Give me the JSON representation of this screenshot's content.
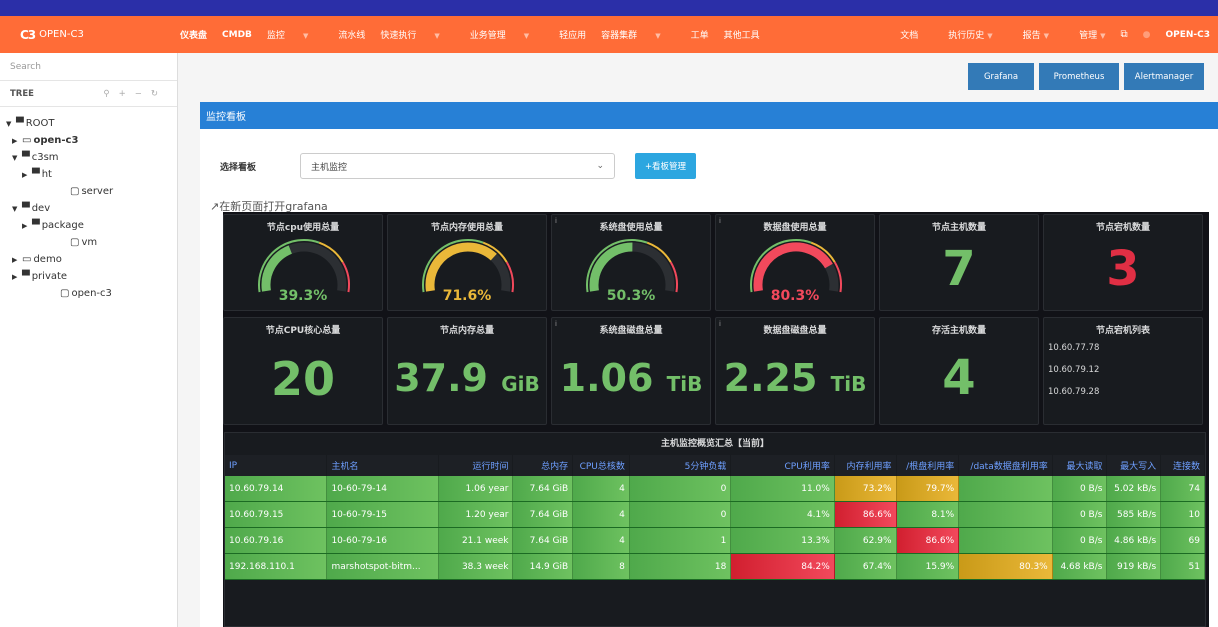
{
  "app": {
    "logo_mark": "C3",
    "logo_text": "OPEN-C3"
  },
  "nav": [
    "仪表盘",
    "CMDB",
    "监控",
    "流水线",
    "快速执行",
    "业务管理",
    "轻应用",
    "容器集群",
    "工单",
    "其他工具"
  ],
  "nav_right": {
    "docs": "文档",
    "history": "执行历史",
    "reports": "报告",
    "admin": "管理",
    "user": "OPEN-C3"
  },
  "sidebar": {
    "search_placeholder": "Search",
    "tree_title": "TREE",
    "nodes": [
      "ROOT",
      "open-c3",
      "c3sm",
      "ht",
      "server",
      "dev",
      "package",
      "vm",
      "demo",
      "private",
      "open-c3"
    ]
  },
  "tool_buttons": [
    "Grafana",
    "Prometheus",
    "Alertmanager"
  ],
  "panel": {
    "title": "监控看板",
    "select_label": "选择看板",
    "select_value": "主机监控",
    "manage_button": "+看板管理",
    "open_link": "在新页面打开grafana"
  },
  "stats": {
    "cpu_usage": {
      "title": "节点cpu使用总量",
      "value": "39.3%",
      "percent": 39.3,
      "color": "#73bf69"
    },
    "mem_usage": {
      "title": "节点内存使用总量",
      "value": "71.6%",
      "percent": 71.6,
      "color": "#eab839"
    },
    "sys_disk": {
      "title": "系统盘使用总量",
      "value": "50.3%",
      "percent": 50.3,
      "color": "#73bf69"
    },
    "data_disk": {
      "title": "数据盘使用总量",
      "value": "80.3%",
      "percent": 80.3,
      "color": "#f2495c"
    },
    "host_count": {
      "title": "节点主机数量",
      "value": "7"
    },
    "down_count": {
      "title": "节点宕机数量",
      "value": "3"
    },
    "cpu_cores": {
      "title": "节点CPU核心总量",
      "value": "20"
    },
    "mem_total": {
      "title": "节点内存总量",
      "value": "37.9",
      "unit": "GiB"
    },
    "sys_disk_total": {
      "title": "系统盘磁盘总量",
      "value": "1.06",
      "unit": "TiB"
    },
    "data_disk_total": {
      "title": "数据盘磁盘总量",
      "value": "2.25",
      "unit": "TiB"
    },
    "alive_count": {
      "title": "存活主机数量",
      "value": "4"
    },
    "down_list": {
      "title": "节点宕机列表",
      "items": [
        "10.60.77.78",
        "10.60.79.12",
        "10.60.79.28"
      ]
    }
  },
  "table": {
    "title": "主机监控概览汇总【当前】",
    "headers": [
      "IP",
      "主机名",
      "运行时间",
      "总内存",
      "CPU总核数",
      "5分钟负载",
      "CPU利用率",
      "内存利用率",
      "/根盘利用率",
      "/data数据盘利用率",
      "最大读取",
      "最大写入",
      "连接数"
    ],
    "rows": [
      [
        "10.60.79.14",
        "10-60-79-14",
        "1.06 year",
        "7.64 GiB",
        "4",
        "0",
        "11.0%",
        "73.2%",
        "79.7%",
        "",
        "0 B/s",
        "5.02 kB/s",
        "74"
      ],
      [
        "10.60.79.15",
        "10-60-79-15",
        "1.20 year",
        "7.64 GiB",
        "4",
        "0",
        "4.1%",
        "86.6%",
        "8.1%",
        "",
        "0 B/s",
        "585 kB/s",
        "10"
      ],
      [
        "10.60.79.16",
        "10-60-79-16",
        "21.1 week",
        "7.64 GiB",
        "4",
        "1",
        "13.3%",
        "62.9%",
        "86.6%",
        "",
        "0 B/s",
        "4.86 kB/s",
        "69"
      ],
      [
        "192.168.110.1",
        "marshotspot-bitm...",
        "38.3 week",
        "14.9 GiB",
        "8",
        "18",
        "84.2%",
        "67.4%",
        "15.9%",
        "80.3%",
        "4.68 kB/s",
        "919 kB/s",
        "51"
      ]
    ],
    "cell_colors": [
      [
        "g",
        "g",
        "g",
        "g",
        "g",
        "g",
        "g",
        "y",
        "y",
        "g",
        "g",
        "g",
        "g"
      ],
      [
        "g",
        "g",
        "g",
        "g",
        "g",
        "g",
        "g",
        "rd",
        "g",
        "g",
        "g",
        "g",
        "g"
      ],
      [
        "g",
        "g",
        "g",
        "g",
        "g",
        "g",
        "g",
        "g",
        "rd",
        "g",
        "g",
        "g",
        "g"
      ],
      [
        "g",
        "g",
        "g",
        "g",
        "g",
        "g",
        "rd",
        "g",
        "g",
        "y",
        "g",
        "g",
        "g"
      ]
    ]
  }
}
